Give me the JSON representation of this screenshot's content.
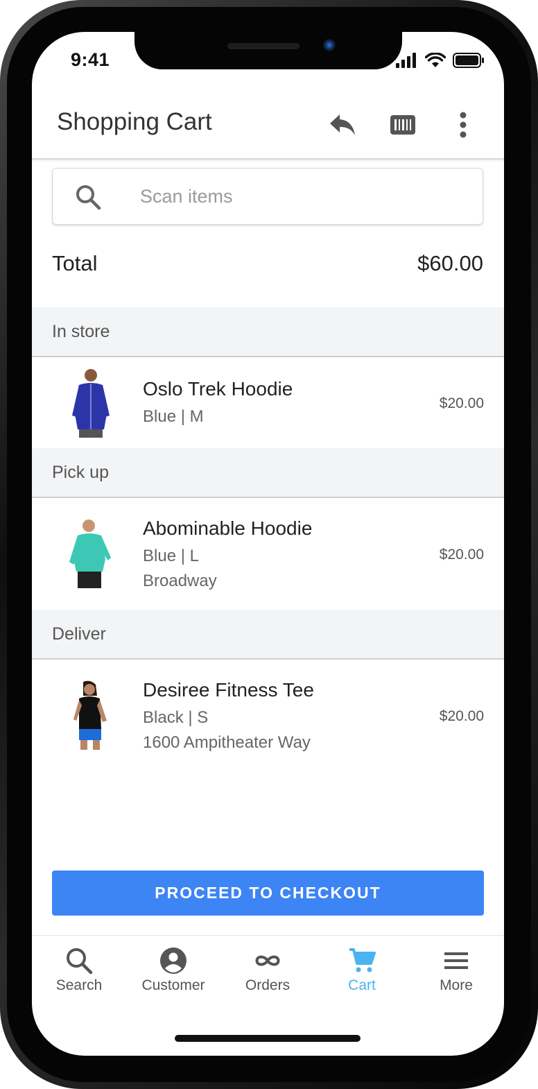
{
  "status_bar": {
    "time": "9:41"
  },
  "header": {
    "title": "Shopping Cart",
    "icons": [
      "reply-icon",
      "barcode-icon",
      "more-vert-icon"
    ]
  },
  "search": {
    "placeholder": "Scan items",
    "value": ""
  },
  "total": {
    "label": "Total",
    "value": "$60.00"
  },
  "sections": [
    {
      "label": "In store",
      "item": {
        "name": "Oslo Trek Hoodie",
        "variant": "Blue | M",
        "detail": "",
        "price": "$20.00",
        "color": "#2b35a8"
      }
    },
    {
      "label": "Pick up",
      "item": {
        "name": "Abominable Hoodie",
        "variant": "Blue | L",
        "detail": "Broadway",
        "price": "$20.00",
        "color": "#3cc8b4"
      }
    },
    {
      "label": "Deliver",
      "item": {
        "name": "Desiree Fitness Tee",
        "variant": "Black | S",
        "detail": "1600 Ampitheater Way",
        "price": "$20.00",
        "color": "#111111"
      }
    }
  ],
  "checkout": {
    "label": "PROCEED TO CHECKOUT",
    "color": "#3d84f5"
  },
  "bottom_nav": {
    "items": [
      {
        "label": "Search",
        "icon": "search-icon",
        "active": false
      },
      {
        "label": "Customer",
        "icon": "account-circle-icon",
        "active": false
      },
      {
        "label": "Orders",
        "icon": "infinity-icon",
        "active": false
      },
      {
        "label": "Cart",
        "icon": "cart-icon",
        "active": true
      },
      {
        "label": "More",
        "icon": "menu-icon",
        "active": false
      }
    ],
    "active_color": "#4ab4f0"
  }
}
